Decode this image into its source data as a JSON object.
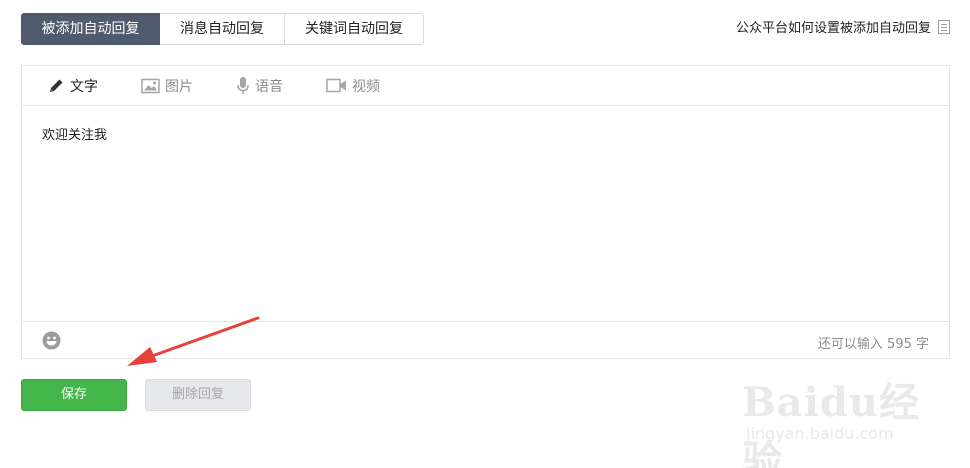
{
  "tabs": [
    {
      "label": "被添加自动回复",
      "active": true
    },
    {
      "label": "消息自动回复",
      "active": false
    },
    {
      "label": "关键词自动回复",
      "active": false
    }
  ],
  "help_link": {
    "label": "公众平台如何设置被添加自动回复",
    "icon": "document-icon"
  },
  "editor": {
    "types": [
      {
        "label": "文字",
        "icon": "pencil-icon",
        "active": true
      },
      {
        "label": "图片",
        "icon": "image-icon",
        "active": false
      },
      {
        "label": "语音",
        "icon": "microphone-icon",
        "active": false
      },
      {
        "label": "视频",
        "icon": "video-icon",
        "active": false
      }
    ],
    "content": "欢迎关注我",
    "emoji_icon": "emoji-icon",
    "counter": "还可以输入 595 字"
  },
  "buttons": {
    "save_label": "保存",
    "delete_label": "删除回复"
  },
  "watermark": {
    "main": "Baidu经验",
    "sub": "jingyan.baidu.com"
  },
  "colors": {
    "active_tab": "#4f5b6d",
    "save_button": "#44b549",
    "arrow": "#e8403a"
  }
}
